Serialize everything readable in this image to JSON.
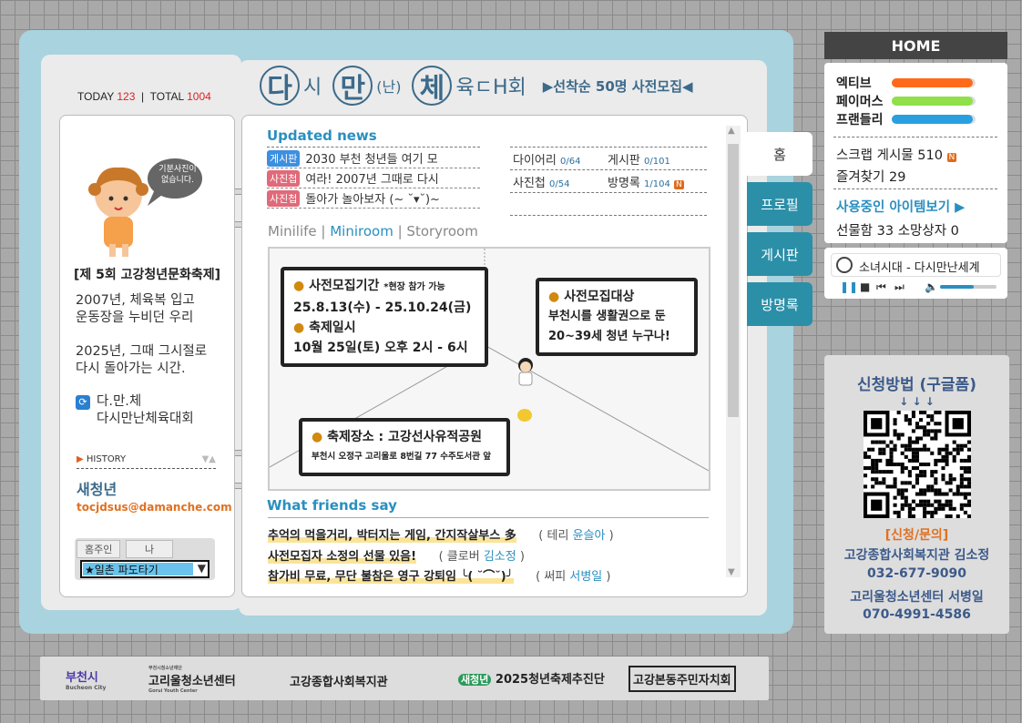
{
  "counter": {
    "today_label": "TODAY",
    "today_value": "123",
    "total_label": "TOTAL",
    "total_value": "1004"
  },
  "title": {
    "c1": "다",
    "t1": "시",
    "c2": "만",
    "t2": "(난)",
    "c3": "체",
    "t3": "육ㄷH회",
    "tagline": "▶선착순 50명 사전모집◀"
  },
  "profile": {
    "speech": "기분사진이 없습니다.",
    "heading": "[제 5회 고강청년문화축제]",
    "p1": [
      "2007년, 체육복 입고",
      "운동장을 누비던 우리"
    ],
    "p2": [
      "2025년, 그때 그시절로",
      "다시 돌아가는 시간."
    ],
    "site_short": "다.만.체",
    "site_full": "다시만난체육대회",
    "history": "HISTORY",
    "name": "새청년",
    "email": "tocjdsus@damanche.com",
    "tab_owner": "홈주인",
    "tab_me": "나",
    "select_value": "★일촌 파도타기"
  },
  "news": {
    "title": "Updated news",
    "items": [
      {
        "badge": "게시판",
        "color": "#3d8fe0",
        "text": "2030 부천 청년들 여기 모"
      },
      {
        "badge": "사진첩",
        "color": "#e06a7a",
        "text": "여라! 2007년 그때로 다시"
      },
      {
        "badge": "사진첩",
        "color": "#e06a7a",
        "text": "돌아가 놀아보자 (~ ˘▾˘)~"
      }
    ]
  },
  "stats": {
    "diary": "다이어리",
    "diary_v": "0/64",
    "board": "게시판",
    "board_v": "0/101",
    "photo": "사진첩",
    "photo_v": "0/54",
    "guest": "방명록",
    "guest_v": "1/104",
    "new": "N"
  },
  "mini": {
    "tab1": "Minilife",
    "tab2": "Miniroom",
    "tab3": "Storyroom"
  },
  "room": {
    "b1_title": "사전모집기간",
    "b1_note": "*현장 참가 가능",
    "b1_date": "25.8.13(수) - 25.10.24(금)",
    "b1_sub": "축제일시",
    "b1_time": "10월 25일(토) 오후 2시 - 6시",
    "b2_title": "사전모집대상",
    "b2_l1": "부천시를 생활권으로 둔",
    "b2_l2": "20~39세 청년 누구나!",
    "b3_title": "축제장소 : 고강선사유적공원",
    "b3_addr": "부천시 오정구 고리울로 8번길 77 수주도서관 앞"
  },
  "friends": {
    "title": "What friends say",
    "items": [
      {
        "msg": "추억의 먹을거리, 박터지는 게임, 간지작살부스 多",
        "rel": "테리",
        "name": "윤슬아"
      },
      {
        "msg": "사전모집자 소정의 선물 있음!",
        "rel": "클로버",
        "name": "김소정"
      },
      {
        "msg": "참가비 무료, 무단 불참은 영구 강퇴임 ╰( ˘⌒˘)╯",
        "rel": "써피",
        "name": "서병일"
      }
    ]
  },
  "tabs": [
    "홈",
    "프로필",
    "게시판",
    "방명록"
  ],
  "right": {
    "home": "HOME",
    "gauges": [
      {
        "label": "엑티브",
        "color": "#ff6a1a",
        "level": 0.97
      },
      {
        "label": "페이머스",
        "color": "#8fe04a",
        "level": 0.97
      },
      {
        "label": "프랜들리",
        "color": "#2a9fe0",
        "level": 0.97
      }
    ],
    "scrap": "스크랩 게시물 510",
    "fav": "즐겨찾기 29",
    "items_link": "사용중인 아이템보기 ▶",
    "gift": "선물함 33 소망상자 0"
  },
  "player": {
    "track": "소녀시대 - 다시만난세계",
    "volume": 0.6
  },
  "apply": {
    "title": "신청방법 (구글폼)",
    "arrows": "↓ ↓ ↓",
    "contact_title": "[신청/문의]",
    "c1": "고강종합사회복지관 김소정",
    "c1_phone": "032-677-9090",
    "c2": "고리울청소년센터 서병일",
    "c2_phone": "070-4991-4586"
  },
  "footer": {
    "l1": "부천시",
    "l1_sub": "Bucheon City",
    "l2_top": "부천시청소년재단",
    "l2": "고리울청소년센터",
    "l2_sub": "Gorui Youth Center",
    "l3": "고강종합사회복지관",
    "l4_badge": "새청년",
    "l4": "2025청년축제추진단",
    "l5": "고강본동주민자치회"
  },
  "colors": {
    "accent": "#2a8fc0",
    "frame": "#a9d3df",
    "tab": "#2b8fa8",
    "title": "#3c6a8a"
  }
}
